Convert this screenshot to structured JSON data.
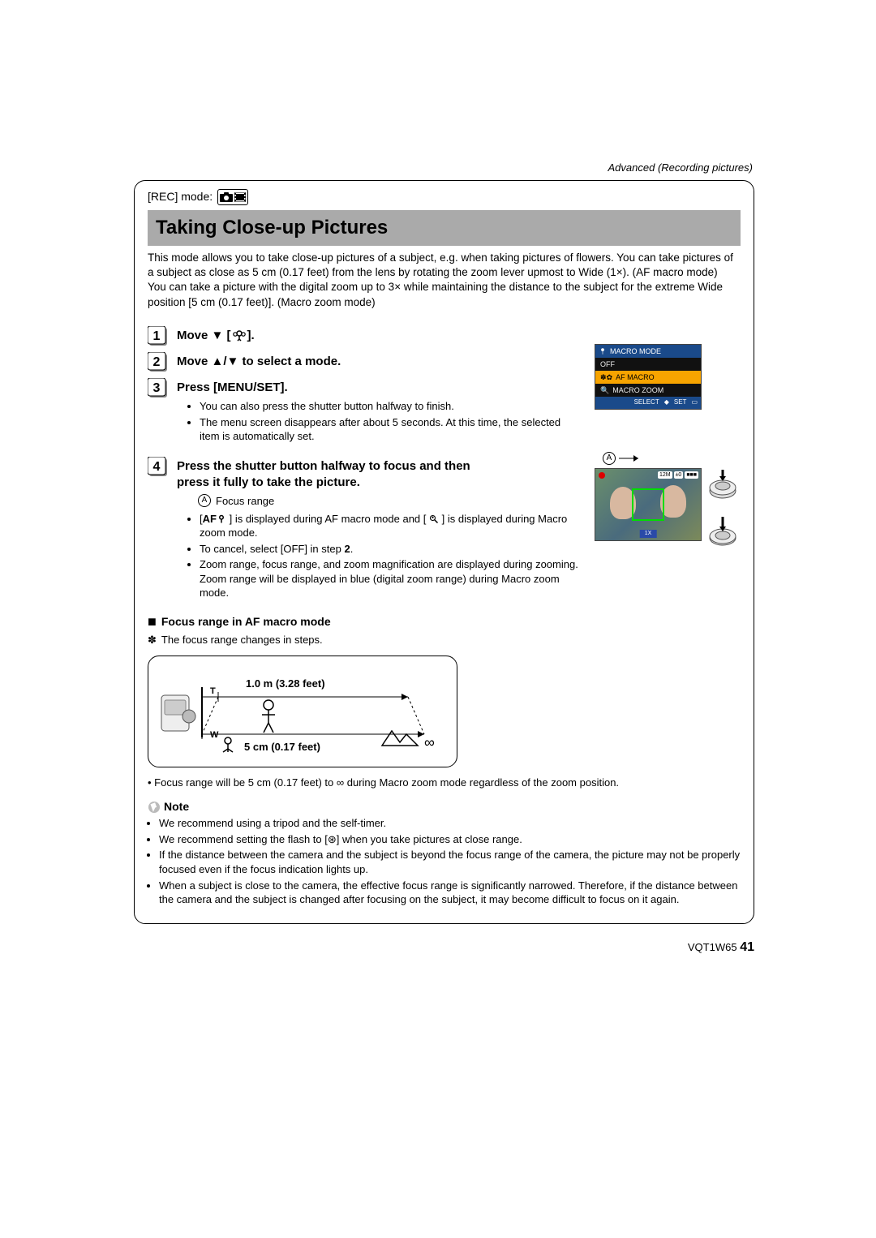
{
  "header": {
    "section": "Advanced (Recording pictures)"
  },
  "rec": {
    "label": "[REC] mode:"
  },
  "title": "Taking Close-up Pictures",
  "intro": "This mode allows you to take close-up pictures of a subject, e.g. when taking pictures of flowers. You can take pictures of a subject as close as 5 cm (0.17 feet) from the lens by rotating the zoom lever upmost to Wide (1×). (AF macro mode)\nYou can take a picture with the digital zoom up to 3× while maintaining the distance to the subject for the extreme Wide position [5 cm (0.17 feet)]. (Macro zoom mode)",
  "step1_pre": "Move ▼ [",
  "step1_post": "].",
  "step2": "Move ▲/▼ to select a mode.",
  "step3_head": "Press [MENU/SET].",
  "step3_bullets": [
    "You can also press the shutter button halfway to finish.",
    "The menu screen disappears after about 5 seconds. At this time, the selected item is automatically set."
  ],
  "step4_head": "Press the shutter button halfway to focus and then press it fully to take the picture.",
  "step4_a_label": "Focus range",
  "step4_bullets_b": "] is displayed during AF macro mode and [",
  "step4_bullets_b2": "] is displayed during Macro zoom mode.",
  "step4_bullets": [
    "To cancel, select [OFF] in step 2.",
    "Zoom range, focus range, and zoom magnification are displayed during zooming. Zoom range will be displayed in blue (digital zoom range) during Macro zoom mode."
  ],
  "menu": {
    "title": "MACRO MODE",
    "rows": [
      "OFF",
      "AF MACRO",
      "MACRO ZOOM"
    ],
    "select": "SELECT",
    "set": "SET"
  },
  "callout_a": "A",
  "photo": {
    "zoom": "1X",
    "px": "12M",
    "quality": "±0",
    "battery": "■■■"
  },
  "focus_head": "Focus range in AF macro mode",
  "focus_note_pre": "✽",
  "focus_note": "The focus range changes in steps.",
  "diagram": {
    "upper": "1.0 m (3.28 feet)",
    "lower": "5 cm (0.17 feet)",
    "T": "T",
    "W": "W"
  },
  "post_diagram": "• Focus range will be 5 cm (0.17 feet) to ∞ during Macro zoom mode regardless of the zoom position.",
  "note_label": "Note",
  "notes": [
    "We recommend using a tripod and the self-timer.",
    "We recommend setting the flash to [⊛] when you take pictures at close range.",
    "If the distance between the camera and the subject is beyond the focus range of the camera, the picture may not be properly focused even if the focus indication lights up.",
    "When a subject is close to the camera, the effective focus range is significantly narrowed. Therefore, if the distance between the camera and the subject is changed after focusing on the subject, it may become difficult to focus on it again."
  ],
  "footer": {
    "code": "VQT1W65",
    "page": "41"
  }
}
